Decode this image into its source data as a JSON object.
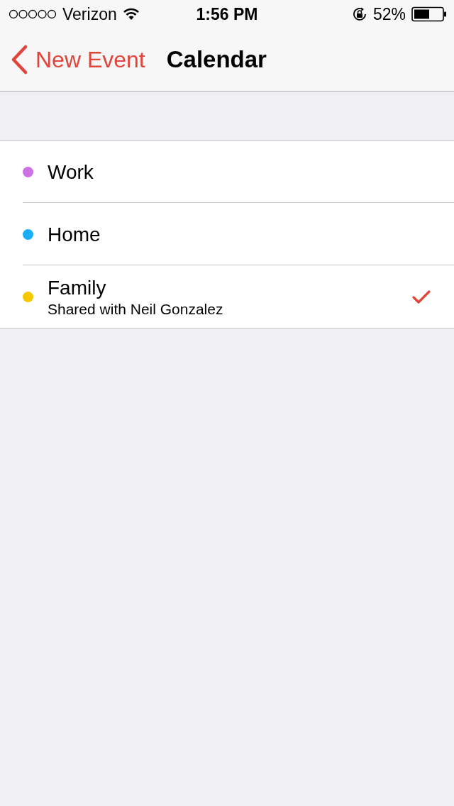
{
  "status_bar": {
    "carrier": "Verizon",
    "time": "1:56 PM",
    "battery": "52%"
  },
  "nav": {
    "back": "New Event",
    "title": "Calendar"
  },
  "calendars": [
    {
      "name": "Work",
      "color": "#cc73e1",
      "selected": false
    },
    {
      "name": "Home",
      "color": "#1badf8",
      "selected": false
    },
    {
      "name": "Family",
      "subtitle": "Shared with Neil Gonzalez",
      "color": "#f5c800",
      "selected": true
    }
  ]
}
